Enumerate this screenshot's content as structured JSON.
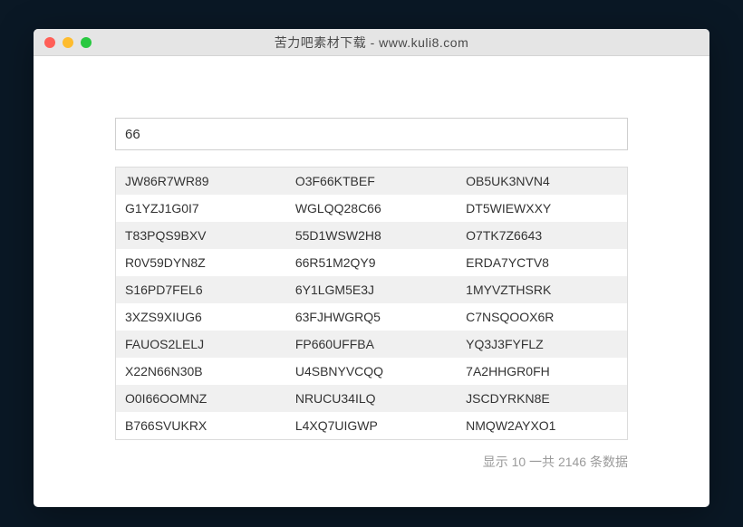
{
  "window": {
    "title": "苦力吧素材下载 - www.kuli8.com"
  },
  "search": {
    "value": "66"
  },
  "table": {
    "rows": [
      [
        "JW86R7WR89",
        "O3F66KTBEF",
        "OB5UK3NVN4"
      ],
      [
        "G1YZJ1G0I7",
        "WGLQQ28C66",
        "DT5WIEWXXY"
      ],
      [
        "T83PQS9BXV",
        "55D1WSW2H8",
        "O7TK7Z6643"
      ],
      [
        "R0V59DYN8Z",
        "66R51M2QY9",
        "ERDA7YCTV8"
      ],
      [
        "S16PD7FEL6",
        "6Y1LGM5E3J",
        "1MYVZTHSRK"
      ],
      [
        "3XZS9XIUG6",
        "63FJHWGRQ5",
        "C7NSQOOX6R"
      ],
      [
        "FAUOS2LELJ",
        "FP660UFFBA",
        "YQ3J3FYFLZ"
      ],
      [
        "X22N66N30B",
        "U4SBNYVCQQ",
        "7A2HHGR0FH"
      ],
      [
        "O0I66OOMNZ",
        "NRUCU34ILQ",
        "JSCDYRKN8E"
      ],
      [
        "B766SVUKRX",
        "L4XQ7UIGWP",
        "NMQW2AYXO1"
      ]
    ]
  },
  "status": {
    "shown": "10",
    "total": "2146",
    "prefix": "显示 ",
    "middle": " 一共 ",
    "suffix": " 条数据"
  }
}
